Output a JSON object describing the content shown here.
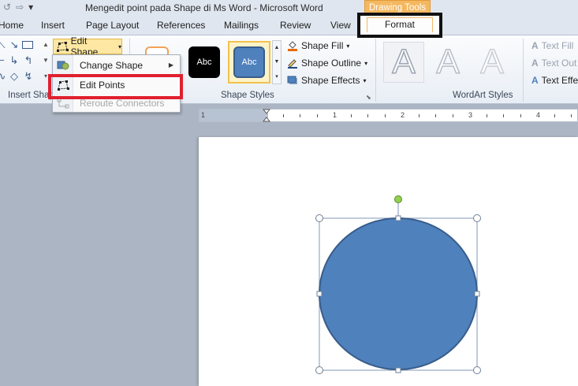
{
  "window": {
    "title": "Mengedit point pada Shape di Ms Word  -  Microsoft Word",
    "context_tab": "Drawing Tools"
  },
  "tabs": [
    "Home",
    "Insert",
    "Page Layout",
    "References",
    "Mailings",
    "Review",
    "View",
    "Format"
  ],
  "ribbon": {
    "edit_shape_label": "Edit Shape",
    "groups": {
      "insert_shapes": "Insert Shap",
      "shape_styles": "Shape Styles",
      "wordart_styles": "WordArt Styles"
    },
    "style_swatches": [
      "Abc",
      "Abc"
    ],
    "format_commands": [
      "Shape Fill",
      "Shape Outline",
      "Shape Effects"
    ],
    "wordart_commands": [
      "Text Fill",
      "Text Out",
      "Text Effe"
    ]
  },
  "menu": {
    "items": [
      {
        "label": "Change Shape",
        "enabled": true,
        "submenu": true
      },
      {
        "label": "Edit Points",
        "enabled": true,
        "submenu": false
      },
      {
        "label": "Reroute Connectors",
        "enabled": false,
        "submenu": false
      }
    ]
  },
  "ruler": {
    "marks": [
      "1",
      "1",
      "2",
      "3",
      "4"
    ]
  },
  "shape": {
    "fill": "#4f81bd",
    "outline": "#385d8a",
    "rotation_handle": "#92d050"
  }
}
